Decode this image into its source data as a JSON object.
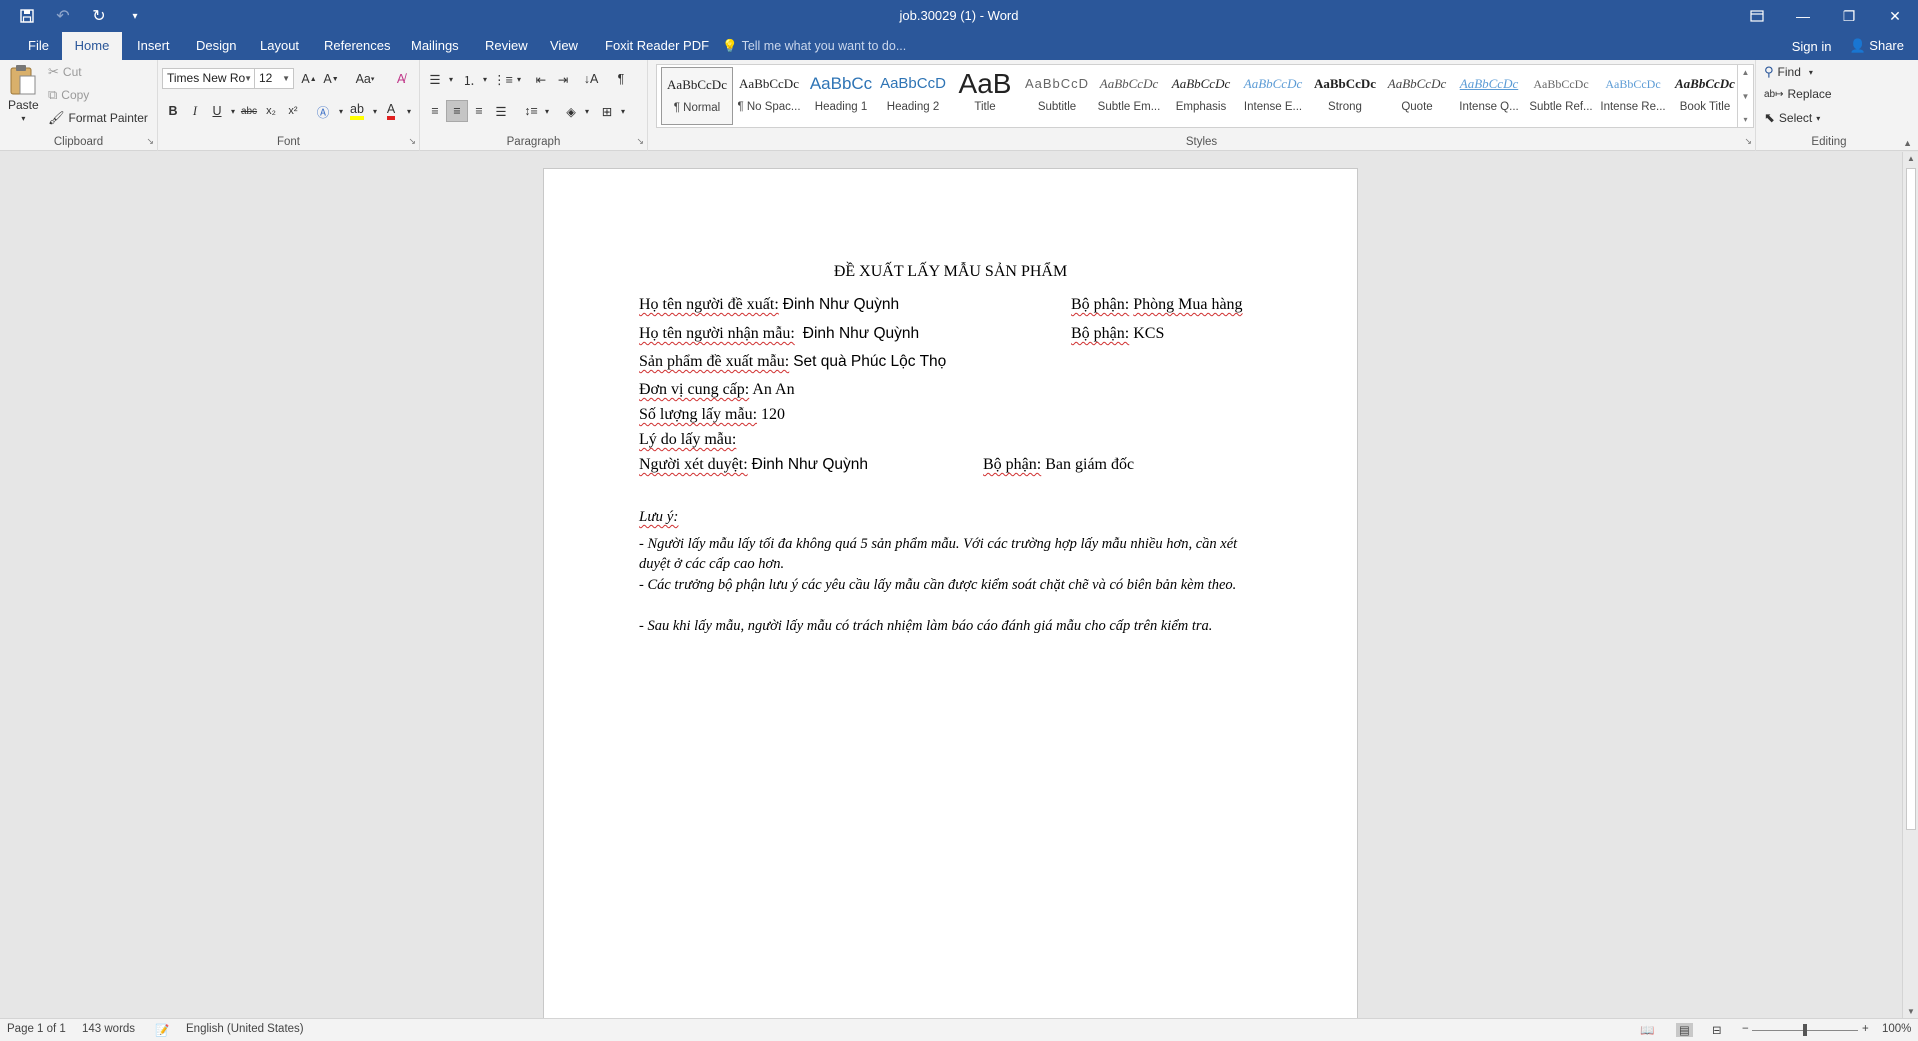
{
  "window": {
    "title": "job.30029 (1) - Word",
    "qat_icons": [
      "save-icon",
      "undo-icon",
      "redo-icon",
      "customize-qat-icon"
    ]
  },
  "tabs": {
    "file": "File",
    "home": "Home",
    "insert": "Insert",
    "design": "Design",
    "layout": "Layout",
    "references": "References",
    "mailings": "Mailings",
    "review": "Review",
    "view": "View",
    "foxit": "Foxit Reader PDF",
    "tell_me": "Tell me what you want to do...",
    "sign_in": "Sign in",
    "share": "Share"
  },
  "ribbon": {
    "clipboard": {
      "label": "Clipboard",
      "paste": "Paste",
      "cut": "Cut",
      "copy": "Copy",
      "format_painter": "Format Painter"
    },
    "font": {
      "label": "Font",
      "font_name": "Times New Ro",
      "font_size": "12",
      "change_case": "Aa",
      "bold": "B",
      "italic": "I",
      "underline": "U",
      "strikethrough": "abc",
      "subscript": "x₂",
      "superscript": "x²"
    },
    "paragraph": {
      "label": "Paragraph"
    },
    "styles": {
      "label": "Styles",
      "items": [
        {
          "sample": "AaBbCcDc",
          "name": "¶ Normal"
        },
        {
          "sample": "AaBbCcDc",
          "name": "¶ No Spac..."
        },
        {
          "sample": "AaBbCc",
          "name": "Heading 1"
        },
        {
          "sample": "AaBbCcD",
          "name": "Heading 2"
        },
        {
          "sample": "AaB",
          "name": "Title"
        },
        {
          "sample": "AaBbCcD",
          "name": "Subtitle"
        },
        {
          "sample": "AaBbCcDc",
          "name": "Subtle Em..."
        },
        {
          "sample": "AaBbCcDc",
          "name": "Emphasis"
        },
        {
          "sample": "AaBbCcDc",
          "name": "Intense E..."
        },
        {
          "sample": "AaBbCcDc",
          "name": "Strong"
        },
        {
          "sample": "AaBbCcDc",
          "name": "Quote"
        },
        {
          "sample": "AaBbCcDc",
          "name": "Intense Q..."
        },
        {
          "sample": "AaBbCcDc",
          "name": "Subtle Ref..."
        },
        {
          "sample": "AaBbCcDc",
          "name": "Intense Re..."
        },
        {
          "sample": "AaBbCcDc",
          "name": "Book Title"
        }
      ]
    },
    "editing": {
      "label": "Editing",
      "find": "Find",
      "replace": "Replace",
      "select": "Select"
    }
  },
  "document": {
    "title": "ĐỀ XUẤT LẤY MẪU SẢN PHẨM",
    "proposer_label": "Họ tên người đề xuất:",
    "proposer_name": "Đinh Như Quỳnh",
    "proposer_dept_label": "Bộ phận:",
    "proposer_dept": "Phòng Mua hàng",
    "receiver_label": "Họ tên người nhận mẫu:",
    "receiver_name": "Đinh Như Quỳnh",
    "receiver_dept_label": "Bộ phận:",
    "receiver_dept": "KCS",
    "product_label": "Sản phẩm đề xuất mẫu:",
    "product": "Set quà Phúc Lộc Thọ",
    "supplier_label": "Đơn vị cung cấp:",
    "supplier": "An An",
    "quantity_label": "Số lượng lấy mẫu:",
    "quantity": "120",
    "reason_label": "Lý do lấy mẫu:",
    "approver_label": "Người xét duyệt:",
    "approver_name": "Đinh Như Quỳnh",
    "approver_dept_label": "Bộ phận:",
    "approver_dept": "Ban giám đốc",
    "note_heading": "Lưu ý:",
    "note1": "- Người lấy mẫu lấy tối đa không quá 5 sản phẩm mẫu. Với các trường hợp lấy mẫu nhiều hơn, cần xét duyệt ở các cấp cao hơn.",
    "note2": "- Các trưởng bộ phận lưu ý các yêu cầu lấy mẫu cần được kiểm soát chặt chẽ và có biên bản kèm theo.",
    "note3": "- Sau khi lấy mẫu, người lấy mẫu có trách nhiệm làm báo cáo đánh giá mẫu cho cấp trên kiểm tra."
  },
  "status": {
    "page": "Page 1 of 1",
    "words": "143 words",
    "language": "English (United States)",
    "zoom": "100%"
  }
}
